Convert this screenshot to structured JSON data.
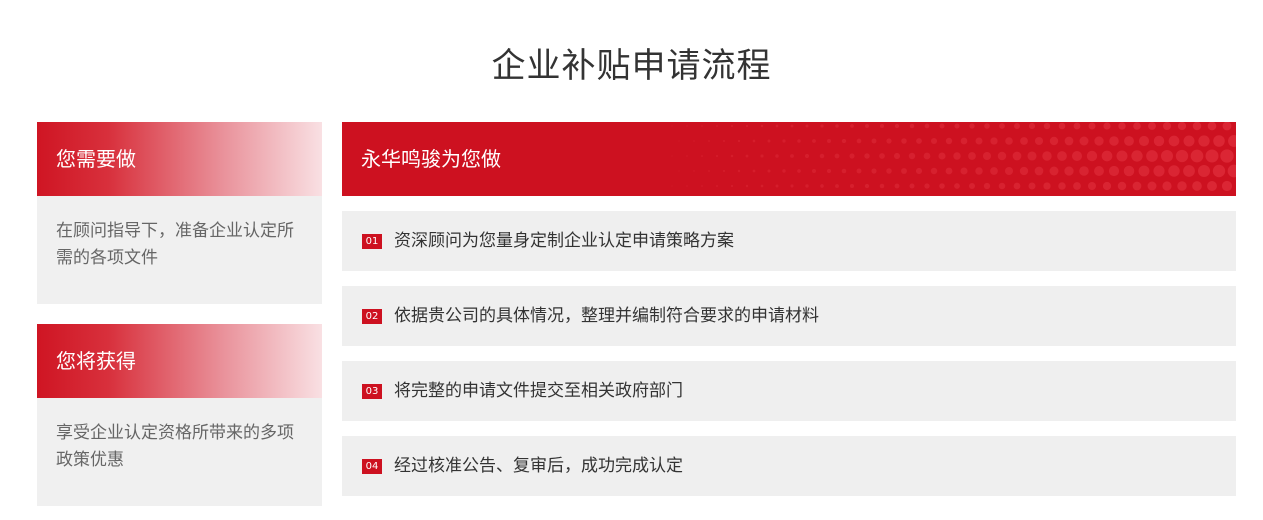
{
  "page_title": "企业补贴申请流程",
  "you_do": {
    "heading": "您需要做",
    "text": "在顾问指导下，准备企业认定所需的各项文件"
  },
  "you_get": {
    "heading": "您将获得",
    "text": "享受企业认定资格所带来的多项政策优惠"
  },
  "we_do": {
    "heading": "永华鸣骏为您做",
    "steps": [
      {
        "num": "01",
        "text": "资深顾问为您量身定制企业认定申请策略方案"
      },
      {
        "num": "02",
        "text": "依据贵公司的具体情况，整理并编制符合要求的申请材料"
      },
      {
        "num": "03",
        "text": "将完整的申请文件提交至相关政府部门"
      },
      {
        "num": "04",
        "text": "经过核准公告、复审后，成功完成认定"
      }
    ]
  },
  "colors": {
    "brand_red": "#cd1120",
    "panel_gray": "#f0f0f0"
  }
}
